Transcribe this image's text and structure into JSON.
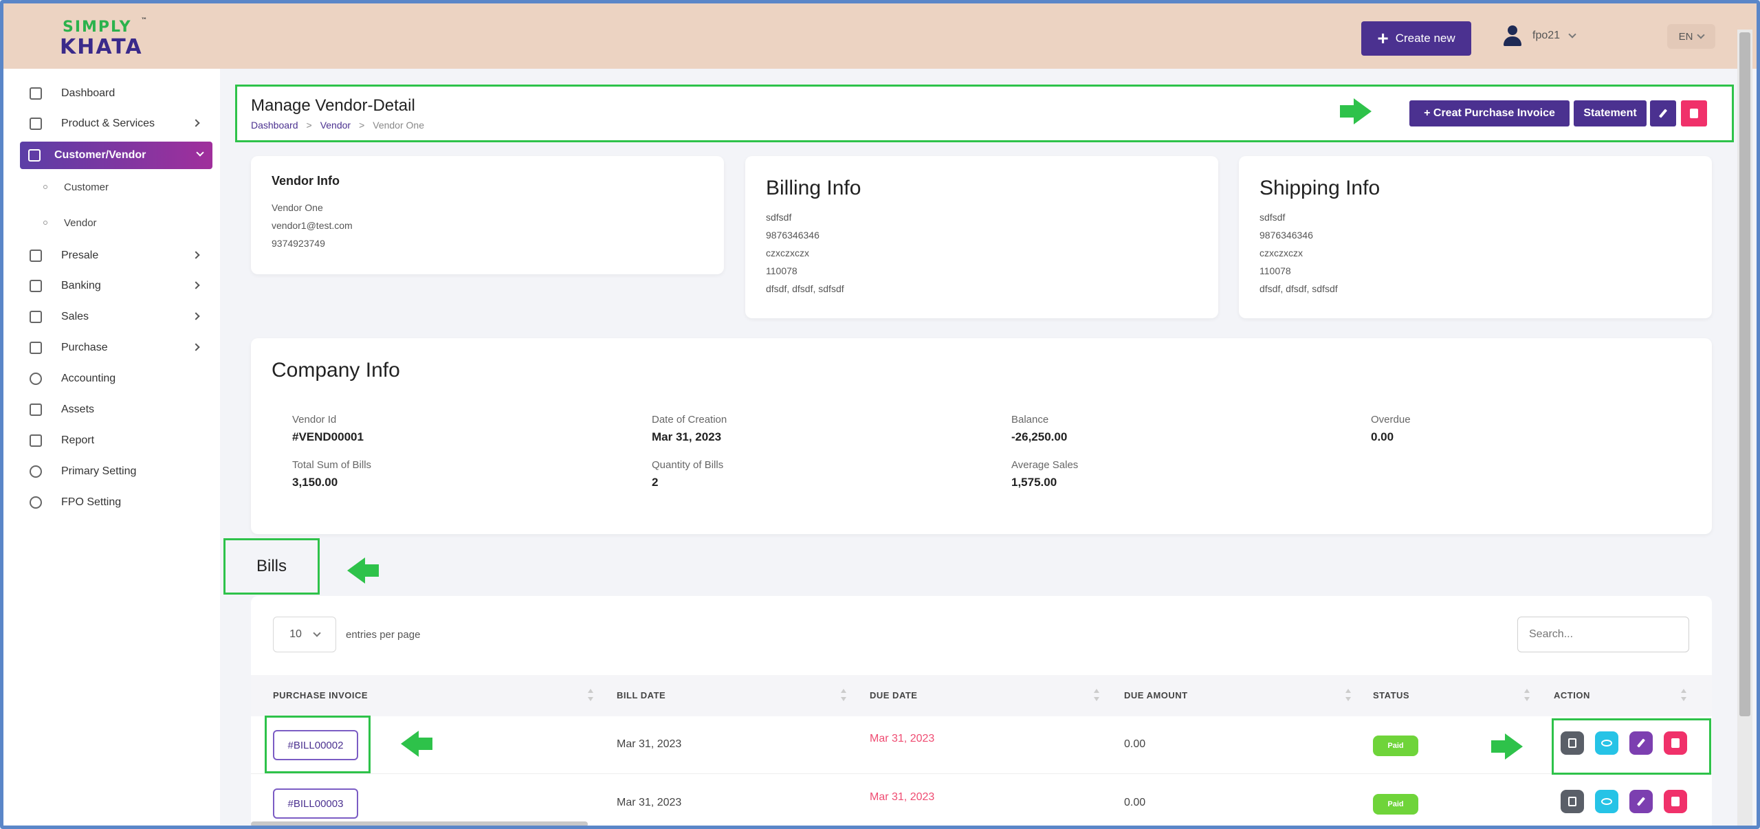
{
  "app": {
    "logo_top": "SIMPLY",
    "logo_tm": "™",
    "logo_bottom": "KHATA",
    "create_new_label": "Create new",
    "user_name": "fpo21",
    "language": "EN"
  },
  "sidebar": {
    "items": [
      {
        "label": "Dashboard",
        "icon": "home-icon"
      },
      {
        "label": "Product & Services",
        "icon": "cart-icon"
      },
      {
        "label": "Customer/Vendor",
        "icon": "users-icon"
      },
      {
        "label": "Presale",
        "icon": "store-icon"
      },
      {
        "label": "Banking",
        "icon": "bank-icon"
      },
      {
        "label": "Sales",
        "icon": "document-icon"
      },
      {
        "label": "Purchase",
        "icon": "bag-icon"
      },
      {
        "label": "Accounting",
        "icon": "globe-icon"
      },
      {
        "label": "Assets",
        "icon": "box-icon"
      },
      {
        "label": "Report",
        "icon": "chart-icon"
      },
      {
        "label": "Primary Setting",
        "icon": "gear-icon"
      },
      {
        "label": "FPO Setting",
        "icon": "settings-icon"
      }
    ],
    "sub_items": [
      "Customer",
      "Vendor"
    ]
  },
  "header": {
    "title": "Manage Vendor-Detail",
    "breadcrumb": [
      "Dashboard",
      "Vendor",
      "Vendor One"
    ],
    "create_invoice_label": "+ Creat Purchase Invoice",
    "statement_label": "Statement"
  },
  "vendor_info": {
    "heading": "Vendor Info",
    "name": "Vendor One",
    "email": "vendor1@test.com",
    "phone": "9374923749"
  },
  "billing_info": {
    "heading": "Billing Info",
    "lines": [
      "sdfsdf",
      "9876346346",
      "czxczxczx",
      "110078",
      "dfsdf, dfsdf, sdfsdf"
    ]
  },
  "shipping_info": {
    "heading": "Shipping Info",
    "lines": [
      "sdfsdf",
      "9876346346",
      "czxczxczx",
      "110078",
      "dfsdf, dfsdf, sdfsdf"
    ]
  },
  "company_info": {
    "heading": "Company Info",
    "fields": [
      {
        "label": "Vendor Id",
        "value": "#VEND00001"
      },
      {
        "label": "Date of Creation",
        "value": "Mar 31, 2023"
      },
      {
        "label": "Balance",
        "value": "-26,250.00"
      },
      {
        "label": "Overdue",
        "value": "0.00"
      },
      {
        "label": "Total Sum of Bills",
        "value": "3,150.00"
      },
      {
        "label": "Quantity of Bills",
        "value": "2"
      },
      {
        "label": "Average Sales",
        "value": "1,575.00"
      }
    ]
  },
  "bills": {
    "heading": "Bills",
    "page_size": "10",
    "entries_per_page": "entries per page",
    "search_placeholder": "Search...",
    "columns": [
      "PURCHASE INVOICE",
      "BILL DATE",
      "DUE DATE",
      "DUE AMOUNT",
      "STATUS",
      "ACTION"
    ],
    "rows": [
      {
        "invoice": "#BILL00002",
        "bill_date": "Mar 31, 2023",
        "due_date": "Mar 31, 2023",
        "due_amount": "0.00",
        "status": "Paid"
      },
      {
        "invoice": "#BILL00003",
        "bill_date": "Mar 31, 2023",
        "due_date": "Mar 31, 2023",
        "due_amount": "0.00",
        "status": "Paid"
      }
    ]
  },
  "colors": {
    "primary": "#4b3190",
    "danger": "#f0316a",
    "paid": "#6fd43a",
    "highlight": "#2ec24a",
    "topbar": "#ecd3c2"
  }
}
